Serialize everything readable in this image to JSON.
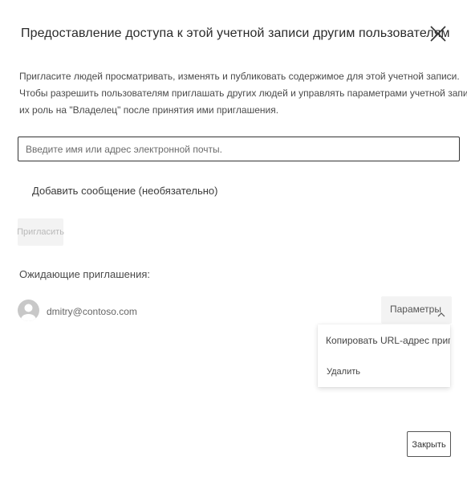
{
  "dialog": {
    "title": "Предоставление доступа к этой учетной записи другим пользователям",
    "description": [
      "Пригласите людей просматривать, изменять и публиковать содержимое для этой учетной записи.",
      "Чтобы разрешить пользователям приглашать других людей и управлять параметрами учетной записи, измените",
      "их роль на \"Владелец\" после принятия ими приглашения."
    ],
    "email_input": {
      "placeholder": "Введите имя или адрес электронной почты.",
      "value": ""
    },
    "add_message_link": "Добавить сообщение (необязательно)",
    "invite_button": "Пригласить",
    "pending_title": "Ожидающие приглашения:",
    "pending_invites": [
      {
        "email": "dmitry@contoso.com",
        "options_label": "Параметры"
      }
    ],
    "options_menu": {
      "items": [
        "Копировать URL-адрес приглашения",
        "Удалить"
      ]
    },
    "close_button": "Закрыть"
  },
  "icons": {
    "close": "close-icon",
    "avatar": "person-icon",
    "options_chevron": "chevron-up-icon"
  },
  "colors": {
    "text": "#333333",
    "muted": "#666666",
    "disabled_button_bg": "#f3f3f3",
    "disabled_button_text": "#b9b9b9",
    "avatar_bg": "#c8c8c8"
  }
}
